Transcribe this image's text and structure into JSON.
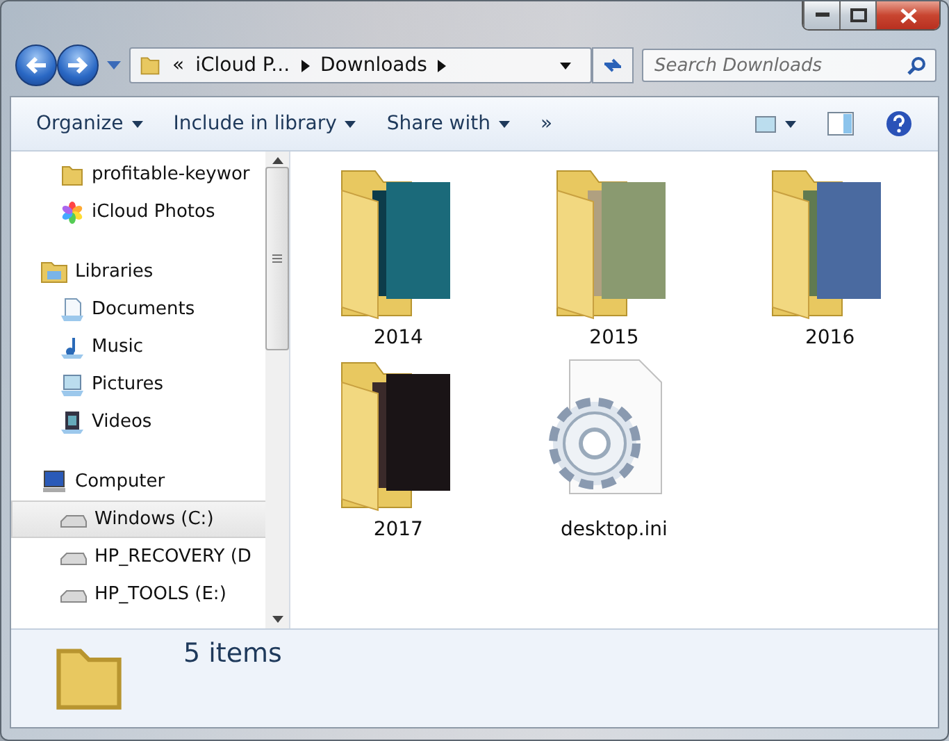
{
  "address_bar": {
    "overflow": "«",
    "crumbs": [
      "iCloud P...",
      "Downloads"
    ]
  },
  "search": {
    "placeholder": "Search Downloads"
  },
  "toolbar": {
    "menus": [
      "Organize",
      "Include in library",
      "Share with"
    ],
    "more": "»"
  },
  "sidebar": {
    "items": [
      {
        "label": "profitable-keywor",
        "kind": "folder",
        "selected": false
      },
      {
        "label": "iCloud Photos",
        "kind": "photos",
        "selected": false
      },
      {
        "label": "Libraries",
        "kind": "library",
        "selected": false
      },
      {
        "label": "Documents",
        "kind": "documents",
        "selected": false
      },
      {
        "label": "Music",
        "kind": "music",
        "selected": false
      },
      {
        "label": "Pictures",
        "kind": "pictures",
        "selected": false
      },
      {
        "label": "Videos",
        "kind": "videos",
        "selected": false
      },
      {
        "label": "Computer",
        "kind": "computer",
        "selected": false
      },
      {
        "label": "Windows (C:)",
        "kind": "drive",
        "selected": true
      },
      {
        "label": "HP_RECOVERY (D",
        "kind": "drive",
        "selected": false
      },
      {
        "label": "HP_TOOLS (E:)",
        "kind": "drive",
        "selected": false
      }
    ]
  },
  "files": [
    {
      "name": "2014",
      "kind": "folder"
    },
    {
      "name": "2015",
      "kind": "folder"
    },
    {
      "name": "2016",
      "kind": "folder"
    },
    {
      "name": "2017",
      "kind": "folder"
    },
    {
      "name": "desktop.ini",
      "kind": "settings"
    }
  ],
  "status": {
    "count": "5 items"
  }
}
